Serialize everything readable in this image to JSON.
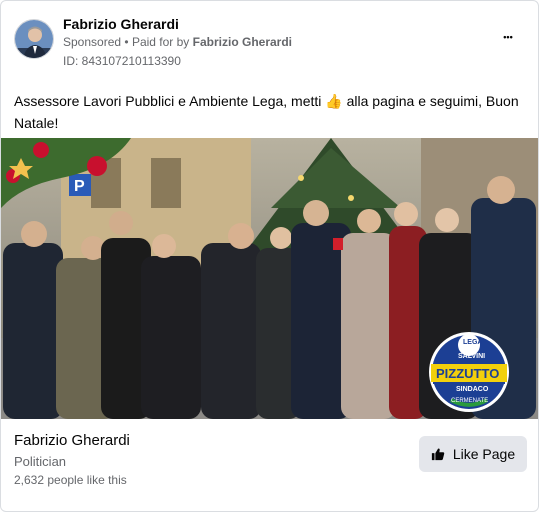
{
  "post": {
    "author": "Fabrizio Gherardi",
    "sponsored_label": "Sponsored",
    "separator": "•",
    "paid_for_prefix": "Paid for by",
    "paid_for_name": "Fabrizio Gherardi",
    "ad_id": "ID: 843107210113390",
    "more_label": "•••",
    "text": "Assessore Lavori Pubblici e Ambiente Lega, metti 👍 alla pagina e seguimi, Buon Natale!"
  },
  "image": {
    "badge_lines": [
      "LEGA",
      "SALVINI",
      "PIZZUTTO",
      "SINDACO",
      "CERMENATE"
    ]
  },
  "footer": {
    "page_name": "Fabrizio Gherardi",
    "category": "Politician",
    "likes": "2,632 people like this",
    "like_button_label": "Like Page"
  },
  "colors": {
    "text_primary": "#050505",
    "text_secondary": "#65676b",
    "button_bg": "#e4e6eb",
    "badge_blue": "#1c3f94",
    "badge_yellow": "#f2d00c",
    "badge_green": "#2a9a3d"
  },
  "icons": {
    "more": "more-dots-icon",
    "like": "thumbs-up-icon"
  }
}
